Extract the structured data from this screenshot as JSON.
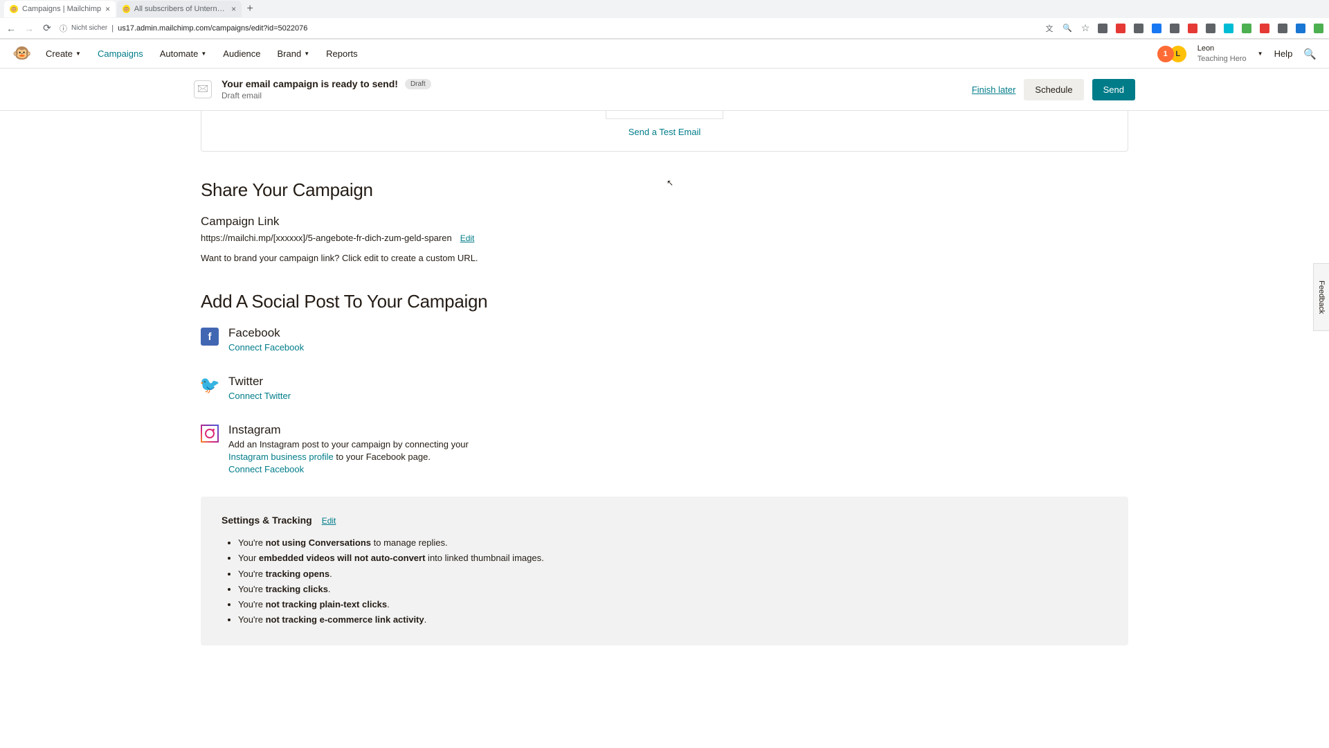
{
  "browser": {
    "tabs": [
      {
        "title": "Campaigns | Mailchimp",
        "active": true
      },
      {
        "title": "All subscribers of Unternehm…",
        "active": false
      }
    ],
    "url_security": "Nicht sicher",
    "url": "us17.admin.mailchimp.com/campaigns/edit?id=5022076"
  },
  "nav": {
    "items": [
      {
        "label": "Create",
        "dropdown": true
      },
      {
        "label": "Campaigns",
        "active": true
      },
      {
        "label": "Automate",
        "dropdown": true
      },
      {
        "label": "Audience"
      },
      {
        "label": "Brand",
        "dropdown": true
      },
      {
        "label": "Reports"
      }
    ],
    "user_name": "Leon",
    "user_sub": "Teaching Hero",
    "help": "Help",
    "avatar1": "1",
    "avatar2": "L"
  },
  "status": {
    "title": "Your email campaign is ready to send!",
    "badge": "Draft",
    "subtitle": "Draft email",
    "finish_later": "Finish later",
    "schedule": "Schedule",
    "send": "Send"
  },
  "preview": {
    "test_label": "Send a Test Email"
  },
  "share": {
    "heading": "Share Your Campaign",
    "link_heading": "Campaign Link",
    "link_url": "https://mailchi.mp/[xxxxxx]/5-angebote-fr-dich-zum-geld-sparen",
    "edit": "Edit",
    "hint": "Want to brand your campaign link? Click edit to create a custom URL."
  },
  "social": {
    "heading": "Add A Social Post To Your Campaign",
    "facebook": {
      "title": "Facebook",
      "connect": "Connect Facebook"
    },
    "twitter": {
      "title": "Twitter",
      "connect": "Connect Twitter"
    },
    "instagram": {
      "title": "Instagram",
      "desc_pre": "Add an Instagram post to your campaign by connecting your ",
      "link": "Instagram business profile",
      "desc_post": " to your Facebook page.",
      "connect": "Connect Facebook"
    }
  },
  "settings": {
    "title": "Settings & Tracking",
    "edit": "Edit",
    "items": [
      {
        "pre": "You're ",
        "bold": "not using Conversations",
        "post": " to manage replies."
      },
      {
        "pre": "Your ",
        "bold": "embedded videos will not auto-convert",
        "post": " into linked thumbnail images."
      },
      {
        "pre": "You're ",
        "bold": "tracking opens",
        "post": "."
      },
      {
        "pre": "You're ",
        "bold": "tracking clicks",
        "post": "."
      },
      {
        "pre": "You're ",
        "bold": "not tracking plain-text clicks",
        "post": "."
      },
      {
        "pre": "You're ",
        "bold": "not tracking e-commerce link activity",
        "post": "."
      }
    ]
  },
  "feedback": "Feedback",
  "ext_colors": [
    "#5f6368",
    "#e53935",
    "#5f6368",
    "#1877f2",
    "#5f6368",
    "#e53935",
    "#5f6368",
    "#00bcd4",
    "#4caf50",
    "#e53935",
    "#5f6368",
    "#1976d2",
    "#4caf50"
  ]
}
